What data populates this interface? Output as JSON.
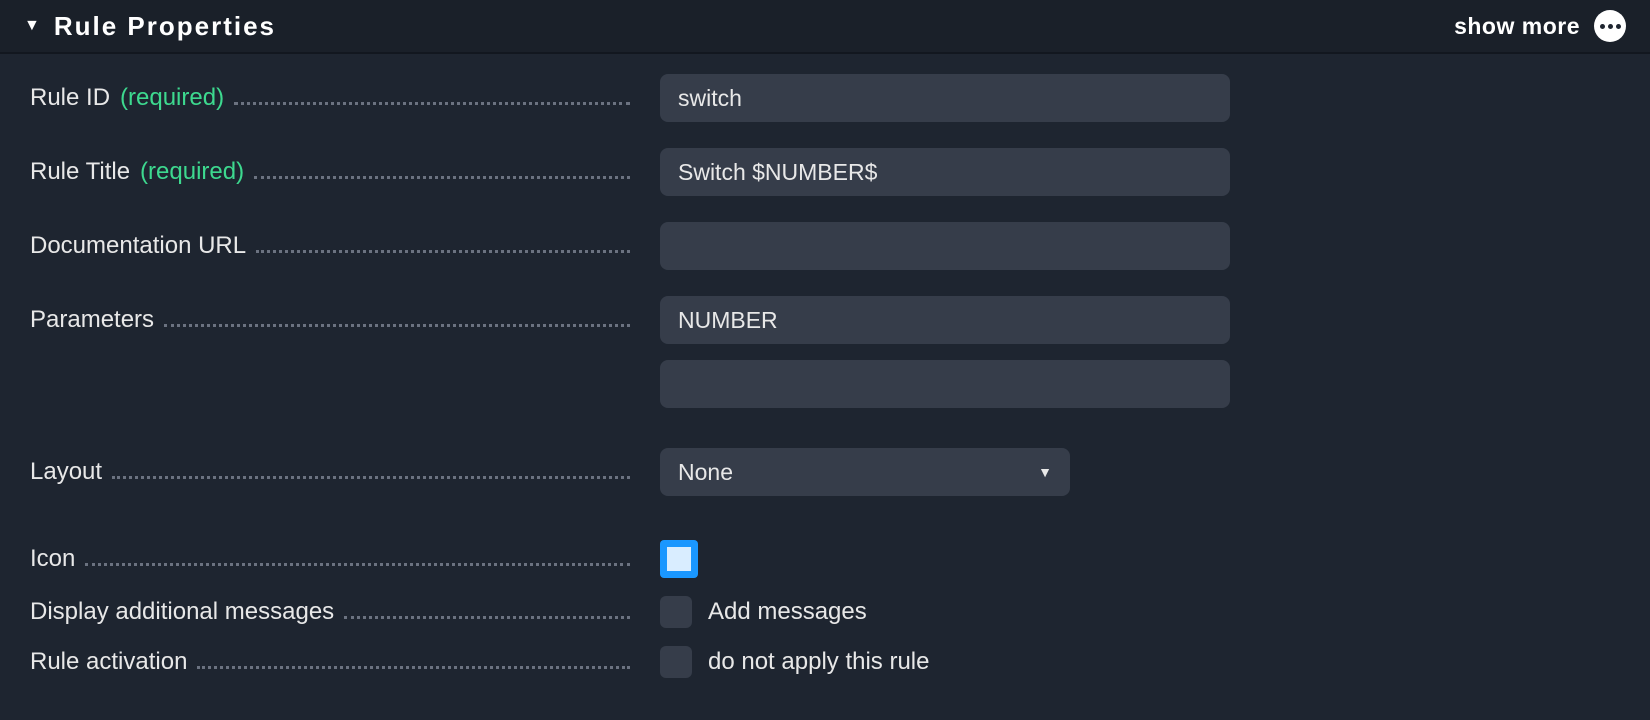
{
  "header": {
    "title": "Rule Properties",
    "showMore": "show more"
  },
  "fields": {
    "ruleId": {
      "label": "Rule ID",
      "required": "(required)",
      "value": "switch"
    },
    "ruleTitle": {
      "label": "Rule Title",
      "required": "(required)",
      "value": "Switch $NUMBER$"
    },
    "docUrl": {
      "label": "Documentation URL",
      "value": ""
    },
    "parameters": {
      "label": "Parameters",
      "value1": "NUMBER",
      "value2": ""
    },
    "layout": {
      "label": "Layout",
      "selected": "None"
    },
    "icon": {
      "label": "Icon"
    },
    "displayAdditional": {
      "label": "Display additional messages",
      "checkLabel": "Add messages"
    },
    "ruleActivation": {
      "label": "Rule activation",
      "checkLabel": "do not apply this rule"
    }
  }
}
